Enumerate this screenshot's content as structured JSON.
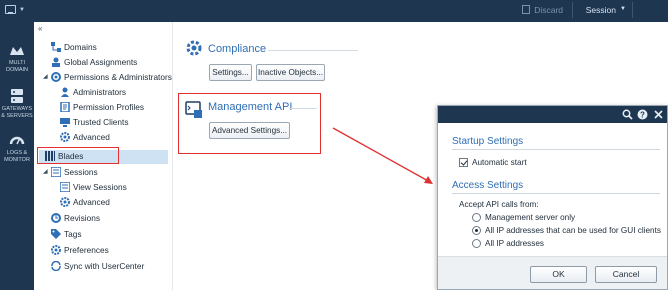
{
  "topbar": {
    "discard_label": "Discard",
    "session_label": "Session"
  },
  "leftnav": {
    "items": [
      {
        "label_line1": "MULTI",
        "label_line2": "DOMAIN",
        "icon": "multi-domain-icon"
      },
      {
        "label_line1": "GATEWAYS",
        "label_line2": "& SERVERS",
        "icon": "gateway-server-icon"
      },
      {
        "label_line1": "LOGS &",
        "label_line2": "MONITOR",
        "icon": "logs-monitor-icon"
      }
    ]
  },
  "tree": {
    "collapse_glyph": "«",
    "items": [
      {
        "label": "Domains",
        "icon": "domains-icon"
      },
      {
        "label": "Global Assignments",
        "icon": "global-assignments-icon"
      },
      {
        "label": "Permissions & Administrators",
        "icon": "permissions-icon",
        "expanded": true
      },
      {
        "label": "Administrators",
        "icon": "administrators-icon"
      },
      {
        "label": "Permission Profiles",
        "icon": "permission-profiles-icon"
      },
      {
        "label": "Trusted Clients",
        "icon": "trusted-clients-icon"
      },
      {
        "label": "Advanced",
        "icon": "gear-icon"
      },
      {
        "label": "Blades",
        "icon": "blades-icon",
        "selected": true
      },
      {
        "label": "Sessions",
        "icon": "sessions-icon",
        "expanded": true
      },
      {
        "label": "View Sessions",
        "icon": "view-sessions-icon"
      },
      {
        "label": "Advanced",
        "icon": "gear-icon"
      },
      {
        "label": "Revisions",
        "icon": "revisions-icon"
      },
      {
        "label": "Tags",
        "icon": "tag-icon"
      },
      {
        "label": "Preferences",
        "icon": "preferences-icon"
      },
      {
        "label": "Sync with UserCenter",
        "icon": "sync-icon"
      }
    ]
  },
  "main": {
    "compliance": {
      "title": "Compliance",
      "settings_button": "Settings...",
      "inactive_objects_button": "Inactive Objects..."
    },
    "management_api": {
      "title": "Management API",
      "advanced_settings_button": "Advanced Settings..."
    }
  },
  "dialog": {
    "startup_title": "Startup Settings",
    "automatic_start_label": "Automatic start",
    "automatic_start_checked": true,
    "access_title": "Access Settings",
    "accept_label": "Accept API calls from:",
    "options": [
      {
        "label": "Management server only",
        "selected": false
      },
      {
        "label": "All IP addresses that can be used for GUI clients",
        "selected": true
      },
      {
        "label": "All IP addresses",
        "selected": false
      }
    ],
    "ok_button": "OK",
    "cancel_button": "Cancel"
  },
  "colors": {
    "nav_bg": "#1e3650",
    "accent_blue": "#2f6fb5",
    "highlight_red": "#e03030",
    "selection_bg": "#cfe2f3"
  }
}
